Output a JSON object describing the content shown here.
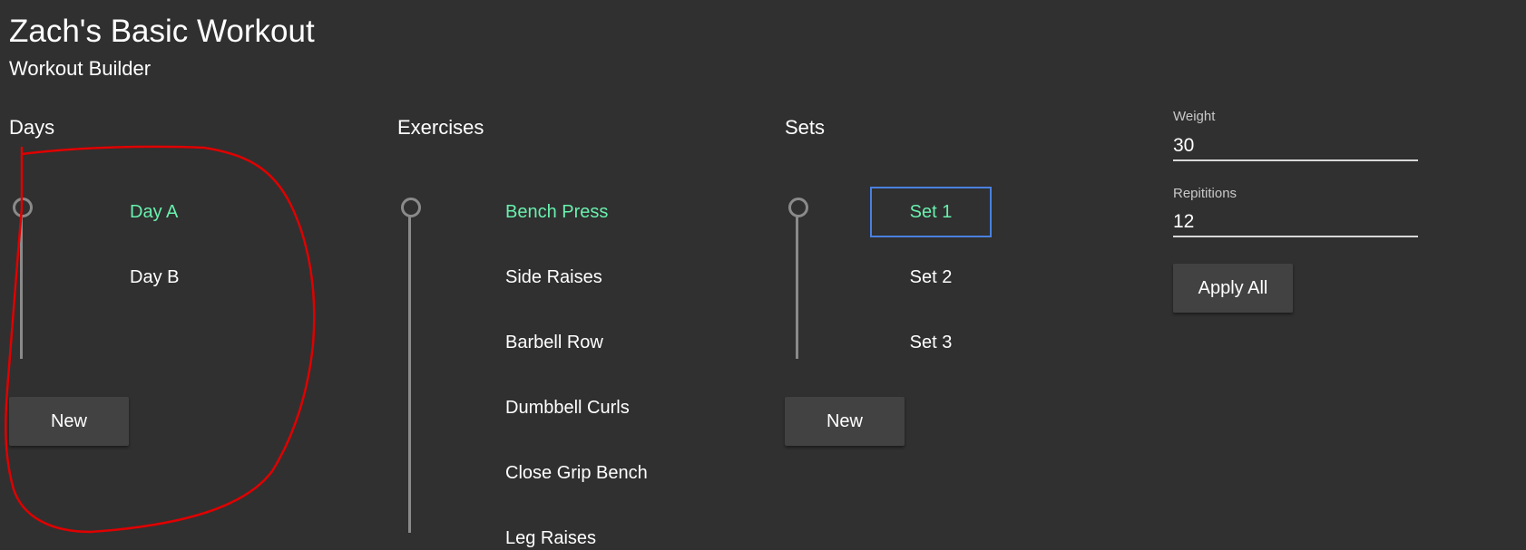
{
  "header": {
    "title": "Zach's Basic Workout",
    "subtitle": "Workout Builder"
  },
  "days": {
    "heading": "Days",
    "items": [
      {
        "label": "Day A",
        "selected": true
      },
      {
        "label": "Day B",
        "selected": false
      }
    ],
    "new_label": "New"
  },
  "exercises": {
    "heading": "Exercises",
    "items": [
      {
        "label": "Bench Press",
        "selected": true
      },
      {
        "label": "Side Raises",
        "selected": false
      },
      {
        "label": "Barbell Row",
        "selected": false
      },
      {
        "label": "Dumbbell Curls",
        "selected": false
      },
      {
        "label": "Close Grip Bench",
        "selected": false
      },
      {
        "label": "Leg Raises",
        "selected": false
      }
    ]
  },
  "sets": {
    "heading": "Sets",
    "items": [
      {
        "label": "Set 1",
        "selected": true
      },
      {
        "label": "Set 2",
        "selected": false
      },
      {
        "label": "Set 3",
        "selected": false
      }
    ],
    "new_label": "New"
  },
  "editor": {
    "weight_label": "Weight",
    "weight_value": "30",
    "reps_label": "Repititions",
    "reps_value": "12",
    "apply_label": "Apply All"
  },
  "colors": {
    "background": "#303030",
    "selected_text": "#69f0ae",
    "focus_border": "#4a80e0",
    "annotation": "#e00000"
  }
}
